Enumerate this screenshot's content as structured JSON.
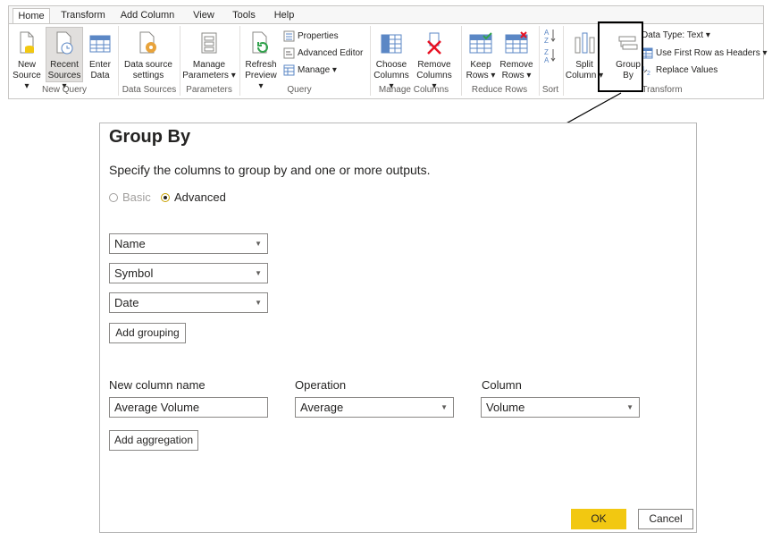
{
  "ribbon": {
    "tabs": [
      "Home",
      "Transform",
      "Add Column",
      "View",
      "Tools",
      "Help"
    ],
    "buttons": {
      "new_source": [
        "New",
        "Source ▾"
      ],
      "recent_sources": [
        "Recent",
        "Sources ▾"
      ],
      "enter_data": [
        "Enter",
        "Data"
      ],
      "data_source_settings": [
        "Data source",
        "settings"
      ],
      "manage_parameters": [
        "Manage",
        "Parameters ▾"
      ],
      "refresh_preview": [
        "Refresh",
        "Preview ▾"
      ],
      "properties": "Properties",
      "advanced_editor": "Advanced Editor",
      "manage": "Manage ▾",
      "choose_columns": [
        "Choose",
        "Columns ▾"
      ],
      "remove_columns": [
        "Remove",
        "Columns ▾"
      ],
      "keep_rows": [
        "Keep",
        "Rows ▾"
      ],
      "remove_rows": [
        "Remove",
        "Rows ▾"
      ],
      "split_column": [
        "Split",
        "Column ▾"
      ],
      "group_by": [
        "Group",
        "By"
      ],
      "data_type": "Data Type: Text ▾",
      "use_first_row": "Use First Row as Headers ▾",
      "replace_values": "Replace Values"
    },
    "groups": {
      "new_query": "New Query",
      "data_sources": "Data Sources",
      "parameters": "Parameters",
      "query": "Query",
      "manage_columns": "Manage Columns",
      "reduce_rows": "Reduce Rows",
      "sort": "Sort",
      "transform": "Transform"
    },
    "icons": [
      "new-source-icon",
      "recent-sources-icon",
      "enter-data-icon",
      "data-source-settings-icon",
      "manage-parameters-icon",
      "refresh-preview-icon",
      "properties-icon",
      "advanced-editor-icon",
      "manage-icon",
      "choose-columns-icon",
      "remove-columns-icon",
      "keep-rows-icon",
      "remove-rows-icon",
      "sort-ascending-icon",
      "sort-descending-icon",
      "split-column-icon",
      "group-by-icon",
      "use-first-row-icon",
      "replace-values-icon"
    ]
  },
  "dialog": {
    "title": "Group By",
    "subtitle": "Specify the columns to group by and one or more outputs.",
    "mode_basic": "Basic",
    "mode_advanced": "Advanced",
    "mode_selected": "Advanced",
    "groupings": [
      "Name",
      "Symbol",
      "Date"
    ],
    "add_grouping": "Add grouping",
    "labels": {
      "new_column_name": "New column name",
      "operation": "Operation",
      "column": "Column"
    },
    "aggregation": {
      "new_column_name": "Average Volume",
      "operation": "Average",
      "column": "Volume"
    },
    "add_aggregation": "Add aggregation",
    "ok": "OK",
    "cancel": "Cancel"
  },
  "colors": {
    "accent": "#f2c811",
    "highlight_border": "#000000",
    "remove_red": "#e81123",
    "icon_blue": "#5b87c5"
  }
}
